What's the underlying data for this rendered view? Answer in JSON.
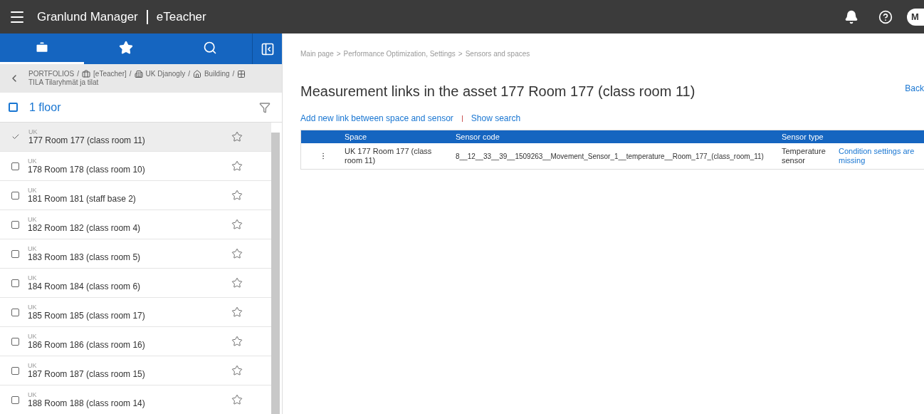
{
  "header": {
    "app": "Granlund Manager",
    "module": "eTeacher",
    "avatar": "M"
  },
  "sidebar": {
    "tabs": [
      {
        "kind": "briefcase",
        "selected": true
      },
      {
        "kind": "star",
        "selected": false
      },
      {
        "kind": "search",
        "selected": false
      }
    ],
    "breadcrumb_separator": "/",
    "breadcrumb": [
      {
        "kind": "plain",
        "label": "PORTFOLIOS"
      },
      {
        "kind": "briefcase",
        "label": "[eTeacher]"
      },
      {
        "kind": "building",
        "label": "UK Djanogly"
      },
      {
        "kind": "home",
        "label": "Building"
      },
      {
        "kind": "grid",
        "label": "TILA Tilaryhmät ja tilat"
      }
    ],
    "group": {
      "label": "1 floor",
      "checked": false
    },
    "items": [
      {
        "prefix": "UK",
        "name": "177 Room 177 (class room 11)",
        "selected": true
      },
      {
        "prefix": "UK",
        "name": "178 Room 178 (class room 10)",
        "selected": false
      },
      {
        "prefix": "UK",
        "name": "181 Room 181 (staff base 2)",
        "selected": false
      },
      {
        "prefix": "UK",
        "name": "182 Room 182 (class room 4)",
        "selected": false
      },
      {
        "prefix": "UK",
        "name": "183 Room 183 (class room 5)",
        "selected": false
      },
      {
        "prefix": "UK",
        "name": "184 Room 184 (class room 6)",
        "selected": false
      },
      {
        "prefix": "UK",
        "name": "185 Room 185 (class room 17)",
        "selected": false
      },
      {
        "prefix": "UK",
        "name": "186 Room 186 (class room 16)",
        "selected": false
      },
      {
        "prefix": "UK",
        "name": "187 Room 187 (class room 15)",
        "selected": false
      },
      {
        "prefix": "UK",
        "name": "188 Room 188 (class room 14)",
        "selected": false
      }
    ]
  },
  "main": {
    "breadcrumb_separator": ">",
    "breadcrumb": [
      "Main page",
      "Performance Optimization, Settings",
      "Sensors and spaces"
    ],
    "title": "Measurement links in the asset 177 Room 177 (class room 11)",
    "back": "Back",
    "actions": [
      "Add new link between space and sensor",
      "Show search"
    ],
    "table": {
      "columns": [
        "Space",
        "Sensor code",
        "Sensor type"
      ],
      "rows": [
        {
          "space": "UK 177 Room 177 (class room 11)",
          "sensor_code": "8__12__33__39__1509263__Movement_Sensor_1__temperature__Room_177_(class_room_11)",
          "sensor_type": "Temperature sensor",
          "status": "Condition settings are missing"
        }
      ]
    }
  }
}
